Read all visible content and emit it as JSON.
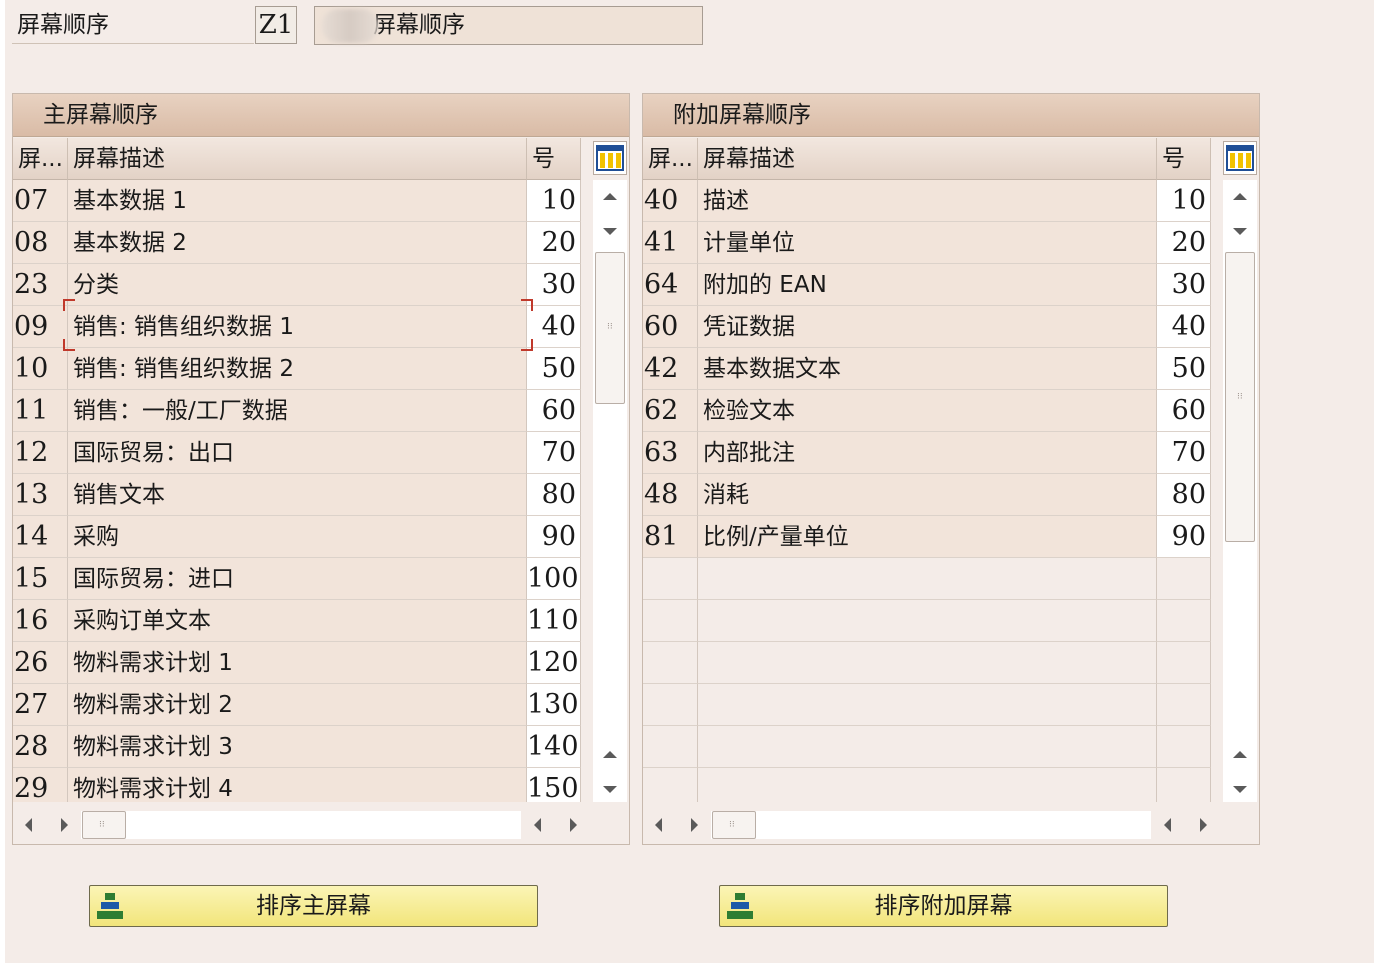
{
  "header": {
    "label": "屏幕顺序",
    "value": "Z1",
    "description": "屏幕顺序"
  },
  "main_panel": {
    "title": "主屏幕顺序",
    "columns": [
      "屏...",
      "屏幕描述",
      "号"
    ],
    "rows": [
      {
        "code": "07",
        "desc": "基本数据 1",
        "num": "10"
      },
      {
        "code": "08",
        "desc": "基本数据 2",
        "num": "20"
      },
      {
        "code": "23",
        "desc": "分类",
        "num": "30"
      },
      {
        "code": "09",
        "desc": "销售: 销售组织数据 1",
        "num": "40"
      },
      {
        "code": "10",
        "desc": "销售: 销售组织数据 2",
        "num": "50"
      },
      {
        "code": "11",
        "desc": "销售：一般/工厂数据",
        "num": "60"
      },
      {
        "code": "12",
        "desc": "国际贸易：出口",
        "num": "70"
      },
      {
        "code": "13",
        "desc": "销售文本",
        "num": "80"
      },
      {
        "code": "14",
        "desc": "采购",
        "num": "90"
      },
      {
        "code": "15",
        "desc": "国际贸易：进口",
        "num": "100"
      },
      {
        "code": "16",
        "desc": "采购订单文本",
        "num": "110"
      },
      {
        "code": "26",
        "desc": "物料需求计划 1",
        "num": "120"
      },
      {
        "code": "27",
        "desc": "物料需求计划 2",
        "num": "130"
      },
      {
        "code": "28",
        "desc": "物料需求计划 3",
        "num": "140"
      },
      {
        "code": "29",
        "desc": "物料需求计划 4",
        "num": "150"
      }
    ]
  },
  "additional_panel": {
    "title": "附加屏幕顺序",
    "columns": [
      "屏...",
      "屏幕描述",
      "号"
    ],
    "rows": [
      {
        "code": "40",
        "desc": "描述",
        "num": "10"
      },
      {
        "code": "41",
        "desc": "计量单位",
        "num": "20"
      },
      {
        "code": "64",
        "desc": "附加的 EAN",
        "num": "30"
      },
      {
        "code": "60",
        "desc": "凭证数据",
        "num": "40"
      },
      {
        "code": "42",
        "desc": "基本数据文本",
        "num": "50"
      },
      {
        "code": "62",
        "desc": "检验文本",
        "num": "60"
      },
      {
        "code": "63",
        "desc": "内部批注",
        "num": "70"
      },
      {
        "code": "48",
        "desc": "消耗",
        "num": "80"
      },
      {
        "code": "81",
        "desc": "比例/产量单位",
        "num": "90"
      },
      {
        "code": "",
        "desc": "",
        "num": ""
      },
      {
        "code": "",
        "desc": "",
        "num": ""
      },
      {
        "code": "",
        "desc": "",
        "num": ""
      },
      {
        "code": "",
        "desc": "",
        "num": ""
      },
      {
        "code": "",
        "desc": "",
        "num": ""
      },
      {
        "code": "",
        "desc": "",
        "num": ""
      }
    ]
  },
  "buttons": {
    "sort_main": "排序主屏幕",
    "sort_additional": "排序附加屏幕"
  },
  "icons": {
    "layout": "table-layout-icon",
    "sort": "sort-icon"
  },
  "colors": {
    "background": "#f4ece8",
    "panel_title": "#d9bba6",
    "button": "#f2e57b",
    "focus": "#c0392b"
  }
}
